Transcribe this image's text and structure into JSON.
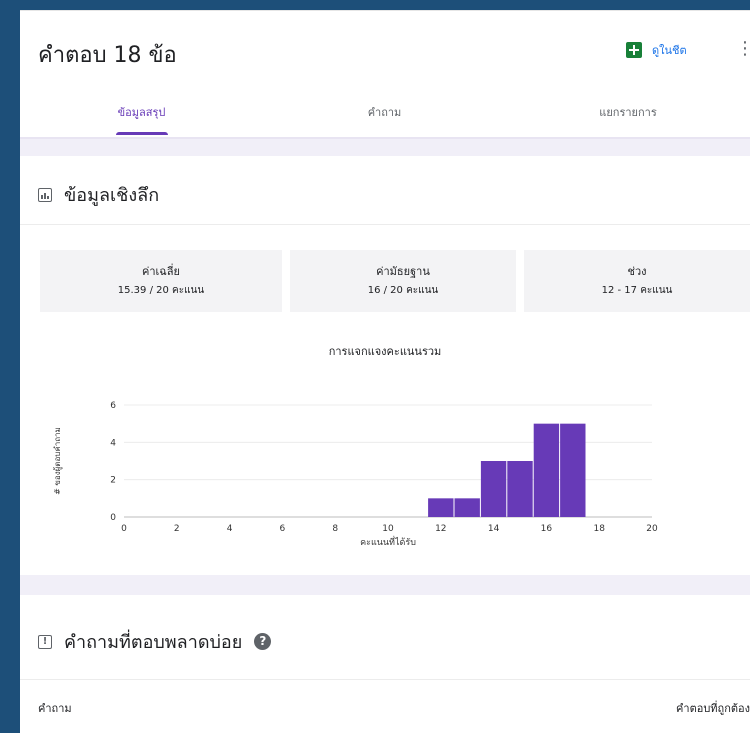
{
  "header": {
    "title": "คำตอบ 18 ข้อ",
    "sheets_label": "ดูในชีต",
    "tabs": [
      {
        "label": "ข้อมูลสรุป",
        "active": true
      },
      {
        "label": "คำถาม",
        "active": false
      },
      {
        "label": "แยกรายการ",
        "active": false
      }
    ]
  },
  "insights": {
    "title": "ข้อมูลเชิงลึก",
    "stats": [
      {
        "label": "ค่าเฉลี่ย",
        "value": "15.39 / 20 คะแนน"
      },
      {
        "label": "ค่ามัธยฐาน",
        "value": "16 / 20 คะแนน"
      },
      {
        "label": "ช่วง",
        "value": "12 - 17 คะแนน"
      }
    ]
  },
  "chart_data": {
    "type": "bar",
    "title": "การแจกแจงคะแนนรวม",
    "xlabel": "คะแนนที่ได้รับ",
    "ylabel": "# ของผู้ตอบคำถาม",
    "x": [
      12,
      13,
      14,
      15,
      16,
      17
    ],
    "values": [
      1,
      1,
      3,
      3,
      5,
      5
    ],
    "xlim": [
      0,
      20
    ],
    "ylim": [
      0,
      6
    ],
    "xticks": [
      0,
      2,
      4,
      6,
      8,
      10,
      12,
      14,
      16,
      18,
      20
    ],
    "yticks": [
      0,
      2,
      4,
      6
    ],
    "bar_color": "#673ab7"
  },
  "mistakes": {
    "title": "คำถามที่ตอบพลาดบ่อย",
    "col_question": "คำถาม",
    "col_correct": "คำตอบที่ถูกต้อง"
  },
  "colors": {
    "accent": "#673ab7",
    "sheets": "#188038",
    "link": "#1a73e8",
    "frame": "#1d4f79"
  }
}
